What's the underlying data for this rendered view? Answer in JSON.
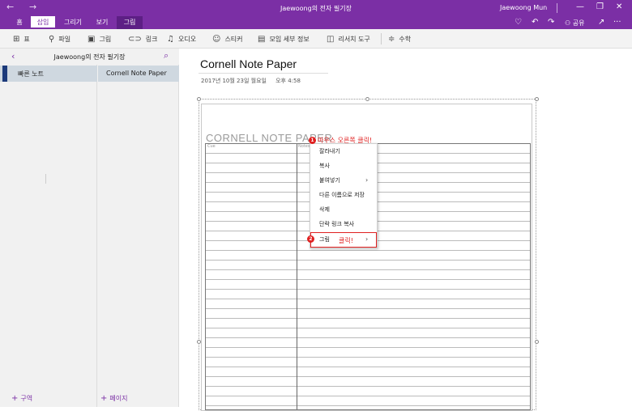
{
  "window": {
    "title": "Jaewoong의 전자 필기장",
    "user": "Jaewoong Mun",
    "back_glyph": "←",
    "forward_glyph": "→",
    "min_glyph": "—",
    "max_glyph": "❐",
    "close_glyph": "✕"
  },
  "tabs": [
    {
      "label": "홈"
    },
    {
      "label": "삽입"
    },
    {
      "label": "그리기"
    },
    {
      "label": "보기"
    },
    {
      "label": "그림"
    }
  ],
  "tabbar_right": {
    "bulb_glyph": "♡",
    "undo_glyph": "↶",
    "redo_glyph": "↷",
    "share_label": "공유",
    "share_glyph": "⚇",
    "expand_glyph": "↗",
    "more_glyph": "···"
  },
  "ribbon": [
    {
      "icon": "table-icon",
      "glyph": "⊞",
      "label": "표"
    },
    {
      "icon": "paperclip-icon",
      "glyph": "⚲",
      "label": "파일"
    },
    {
      "icon": "picture-icon",
      "glyph": "▣",
      "label": "그림"
    },
    {
      "icon": "link-icon",
      "glyph": "⊂⊃",
      "label": "링크"
    },
    {
      "icon": "microphone-icon",
      "glyph": "♫",
      "label": "오디오"
    },
    {
      "icon": "smiley-icon",
      "glyph": "☺",
      "label": "스티커"
    },
    {
      "icon": "calendar-icon",
      "glyph": "▤",
      "label": "모임 세부 정보"
    },
    {
      "icon": "researcher-icon",
      "glyph": "◫",
      "label": "리서치 도구"
    },
    {
      "icon": "math-icon",
      "glyph": "≑",
      "label": "수학"
    }
  ],
  "notebook": {
    "name": "Jaewoong의 전자 필기장",
    "back_glyph": "‹",
    "search_glyph": "⌕"
  },
  "sections": [
    {
      "label": "빠른 노트"
    }
  ],
  "pages": [
    {
      "label": "Cornell Note Paper"
    }
  ],
  "footer": {
    "add_section": "구역",
    "add_page": "페이지",
    "plus_glyph": "+"
  },
  "page": {
    "title": "Cornell Note Paper",
    "date": "2017년 10월 23일 월요일",
    "time": "오후 4:58"
  },
  "image": {
    "title": "CORNELL NOTE PAPER",
    "cue_label": "Cue",
    "notes_label": "Notes"
  },
  "context_menu": {
    "items": [
      {
        "label": "잘라내기"
      },
      {
        "label": "복사"
      },
      {
        "label": "붙여넣기"
      },
      {
        "label": "다른 이름으로 저장"
      },
      {
        "label": "삭제"
      },
      {
        "label": "단락 링크 복사"
      },
      {
        "label": "그림"
      }
    ],
    "submenu_glyph": "›"
  },
  "annotations": {
    "step1_number": "1",
    "step1_text": "마우스 오른쪽 클릭!",
    "step2_number": "2",
    "step2_text": "클릭!",
    "color": "#e02020"
  },
  "colors": {
    "accent": "#7b2fa5",
    "selected_item": "#cfd8e0",
    "section_stripe": "#1c3a7a"
  }
}
